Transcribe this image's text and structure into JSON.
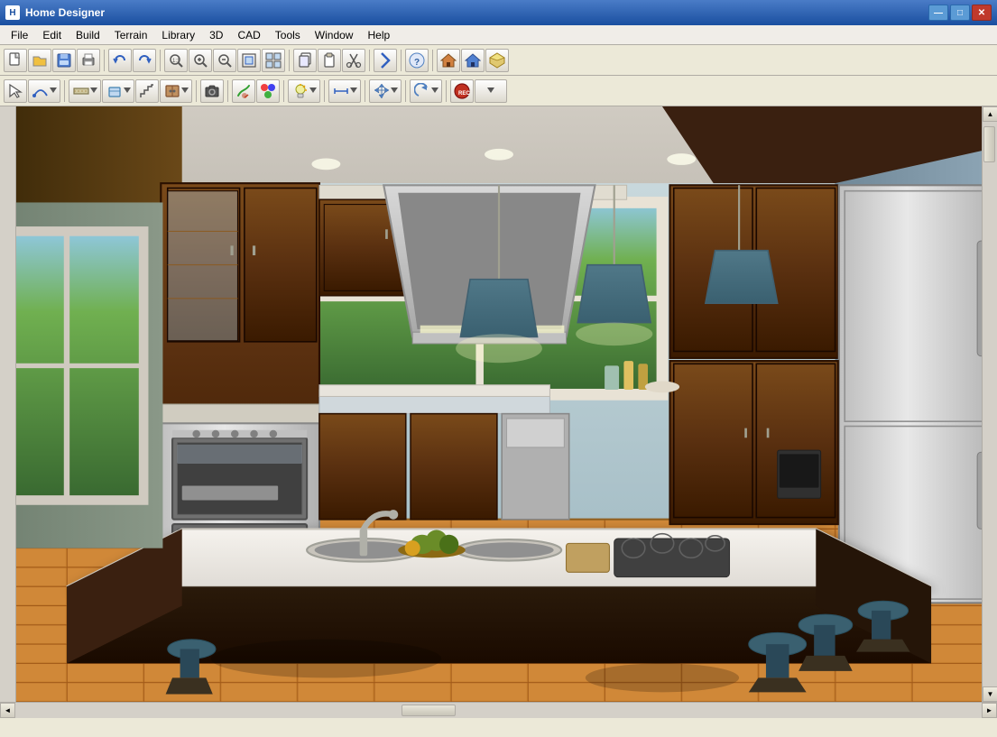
{
  "window": {
    "title": "Home Designer",
    "icon": "H",
    "controls": {
      "minimize": "—",
      "maximize": "□",
      "close": "✕"
    }
  },
  "menu": {
    "items": [
      {
        "id": "file",
        "label": "File"
      },
      {
        "id": "edit",
        "label": "Edit"
      },
      {
        "id": "build",
        "label": "Build"
      },
      {
        "id": "terrain",
        "label": "Terrain"
      },
      {
        "id": "library",
        "label": "Library"
      },
      {
        "id": "3d",
        "label": "3D"
      },
      {
        "id": "cad",
        "label": "CAD"
      },
      {
        "id": "tools",
        "label": "Tools"
      },
      {
        "id": "window",
        "label": "Window"
      },
      {
        "id": "help",
        "label": "Help"
      }
    ]
  },
  "toolbar1": {
    "buttons": [
      {
        "id": "new",
        "icon": "📄",
        "tooltip": "New"
      },
      {
        "id": "open",
        "icon": "📂",
        "tooltip": "Open"
      },
      {
        "id": "save",
        "icon": "💾",
        "tooltip": "Save"
      },
      {
        "id": "print",
        "icon": "🖨",
        "tooltip": "Print"
      },
      {
        "id": "undo",
        "icon": "↩",
        "tooltip": "Undo"
      },
      {
        "id": "redo",
        "icon": "↪",
        "tooltip": "Redo"
      },
      {
        "id": "zoom-in",
        "icon": "🔍",
        "tooltip": "Zoom In"
      },
      {
        "id": "zoom-out",
        "icon": "🔍",
        "tooltip": "Zoom Out"
      },
      {
        "id": "zoom-fit",
        "icon": "⊡",
        "tooltip": "Zoom to Fit"
      },
      {
        "id": "select-all",
        "icon": "⊞",
        "tooltip": "Select All"
      },
      {
        "id": "copy",
        "icon": "⧉",
        "tooltip": "Copy"
      },
      {
        "id": "paste",
        "icon": "📋",
        "tooltip": "Paste"
      },
      {
        "id": "arrow-up",
        "icon": "↑",
        "tooltip": "Arrow Up"
      },
      {
        "id": "help-btn",
        "icon": "?",
        "tooltip": "Help"
      },
      {
        "id": "house-front",
        "icon": "🏠",
        "tooltip": "Front View"
      },
      {
        "id": "house-top",
        "icon": "⌂",
        "tooltip": "Top View"
      },
      {
        "id": "house-3d",
        "icon": "🏡",
        "tooltip": "3D View"
      }
    ]
  },
  "toolbar2": {
    "buttons": [
      {
        "id": "select",
        "icon": "↖",
        "tooltip": "Select"
      },
      {
        "id": "draw-arc",
        "icon": "⌒",
        "tooltip": "Draw Arc"
      },
      {
        "id": "draw-line",
        "icon": "—",
        "tooltip": "Draw Line"
      },
      {
        "id": "floor-plan",
        "icon": "⊟",
        "tooltip": "Floor Plan"
      },
      {
        "id": "furniture",
        "icon": "🪑",
        "tooltip": "Furniture"
      },
      {
        "id": "cabinet",
        "icon": "⊡",
        "tooltip": "Cabinet"
      },
      {
        "id": "camera",
        "icon": "📷",
        "tooltip": "Camera"
      },
      {
        "id": "paint",
        "icon": "🖌",
        "tooltip": "Paint"
      },
      {
        "id": "material",
        "icon": "◈",
        "tooltip": "Material"
      },
      {
        "id": "light",
        "icon": "💡",
        "tooltip": "Light"
      },
      {
        "id": "dimension",
        "icon": "⟺",
        "tooltip": "Dimension"
      },
      {
        "id": "move",
        "icon": "✥",
        "tooltip": "Move"
      },
      {
        "id": "rotate",
        "icon": "↻",
        "tooltip": "Rotate"
      },
      {
        "id": "rec",
        "icon": "⏺",
        "tooltip": "Record"
      }
    ]
  },
  "viewport": {
    "scene": "3D Kitchen Render",
    "description": "Modern kitchen with island, dark wood cabinets, stainless appliances"
  },
  "statusbar": {
    "text": ""
  }
}
